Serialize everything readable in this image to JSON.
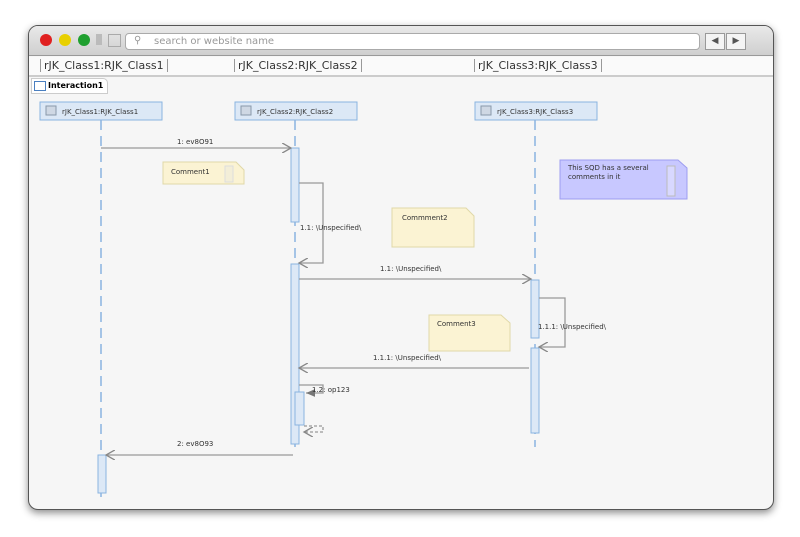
{
  "browser": {
    "search_placeholder": "search or website name",
    "back_icon": "◀",
    "forward_icon": "▶"
  },
  "header": {
    "lifelines": [
      "rJK_Class1:RJK_Class1",
      "rJK_Class2:RJK_Class2",
      "rJK_Class3:RJK_Class3"
    ]
  },
  "tab": {
    "label": "Interaction1"
  },
  "diagram": {
    "lifelines": [
      "rJK_Class1:RJK_Class1",
      "rJK_Class2:RJK_Class2",
      "rJK_Class3:RJK_Class3"
    ],
    "messages": [
      "1: ev8O91",
      "1.1: \\Unspecified\\",
      "1.1: \\Unspecified\\",
      "1.1.1: \\Unspecified\\",
      "1.1.1: \\Unspecified\\",
      "1.2: op123",
      "2: ev8O93"
    ],
    "comments": [
      "Comment1",
      "Commment2",
      "Comment3"
    ],
    "note": {
      "line1": "This SQD has a several",
      "line2": "comments in it",
      "color": "#c8c8ff"
    },
    "lifeline_color": "#8ab4e0",
    "comment_color": "#fbf3d3"
  }
}
